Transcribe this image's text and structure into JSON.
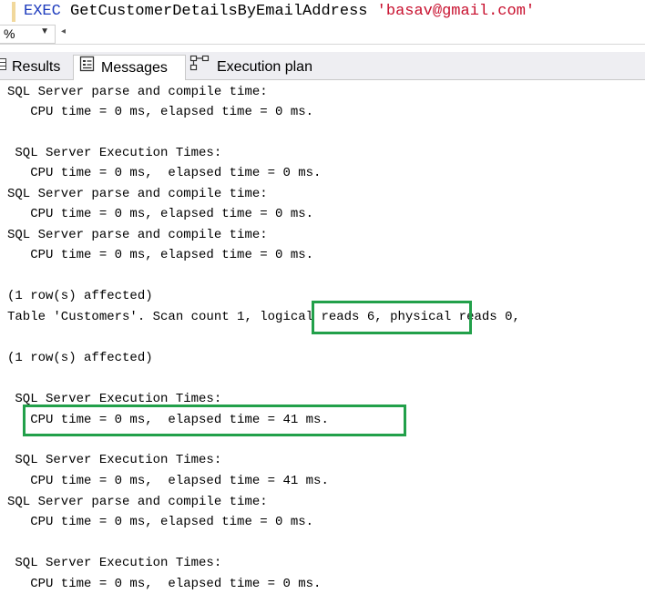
{
  "editor": {
    "keyword": "EXEC",
    "procedure": "GetCustomerDetailsByEmailAddress",
    "argument": "'basav@gmail.com'"
  },
  "zoom": {
    "value": "%",
    "dropdown_icon": "chevron-down-icon"
  },
  "tabs": [
    {
      "label": "Results",
      "icon": "grid-icon"
    },
    {
      "label": "Messages",
      "icon": "messages-icon",
      "active": true
    },
    {
      "label": "Execution plan",
      "icon": "execution-plan-icon"
    }
  ],
  "messages": {
    "lines": [
      "SQL Server parse and compile time:",
      "   CPU time = 0 ms, elapsed time = 0 ms.",
      "",
      " SQL Server Execution Times:",
      "   CPU time = 0 ms,  elapsed time = 0 ms.",
      "SQL Server parse and compile time:",
      "   CPU time = 0 ms, elapsed time = 0 ms.",
      "SQL Server parse and compile time:",
      "   CPU time = 0 ms, elapsed time = 0 ms.",
      "",
      "(1 row(s) affected)",
      "Table 'Customers'. Scan count 1, logical reads 6, physical reads 0,",
      "",
      "(1 row(s) affected)",
      "",
      " SQL Server Execution Times:",
      "   CPU time = 0 ms,  elapsed time = 41 ms.",
      "",
      " SQL Server Execution Times:",
      "   CPU time = 0 ms,  elapsed time = 41 ms.",
      "SQL Server parse and compile time:",
      "   CPU time = 0 ms, elapsed time = 0 ms.",
      "",
      " SQL Server Execution Times:",
      "   CPU time = 0 ms,  elapsed time = 0 ms."
    ]
  },
  "highlight_color": "#22a04a"
}
